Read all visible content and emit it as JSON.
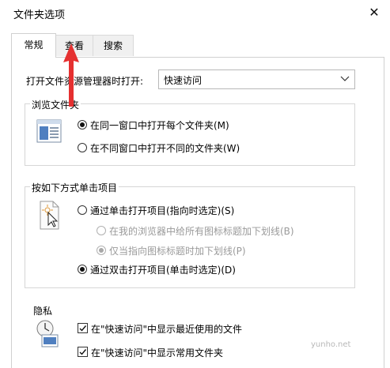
{
  "window": {
    "title": "文件夹选项",
    "close_symbol": "✕"
  },
  "tabs": [
    {
      "label": "常规",
      "active": true
    },
    {
      "label": "查看",
      "active": false
    },
    {
      "label": "搜索",
      "active": false
    }
  ],
  "open_explorer": {
    "label": "打开文件资源管理器时打开:",
    "selected": "快速访问"
  },
  "browse_folders": {
    "legend": "浏览文件夹",
    "icon": "folder-window-icon",
    "options": [
      {
        "label": "在同一窗口中打开每个文件夹(M)",
        "checked": true
      },
      {
        "label": "在不同窗口中打开不同的文件夹(W)",
        "checked": false
      }
    ]
  },
  "click_items": {
    "legend": "按如下方式单击项目",
    "icon": "pointer-click-icon",
    "single_click": {
      "label": "通过单击打开项目(指向时选定)(S)",
      "checked": false
    },
    "underline_options": [
      {
        "label": "在我的浏览器中给所有图标标题加下划线(B)",
        "checked": false,
        "disabled": true
      },
      {
        "label": "仅当指向图标标题时加下划线(P)",
        "checked": true,
        "disabled": true
      }
    ],
    "double_click": {
      "label": "通过双击打开项目(单击时选定)(D)",
      "checked": true
    }
  },
  "privacy": {
    "legend": "隐私",
    "icon": "privacy-clock-icon",
    "checks": [
      {
        "label": "在\"快速访问\"中显示最近使用的文件",
        "checked": true
      },
      {
        "label": "在\"快速访问\"中显示常用文件夹",
        "checked": true
      }
    ]
  },
  "annotation": {
    "color": "#e53030"
  },
  "watermark": "yunho.net"
}
